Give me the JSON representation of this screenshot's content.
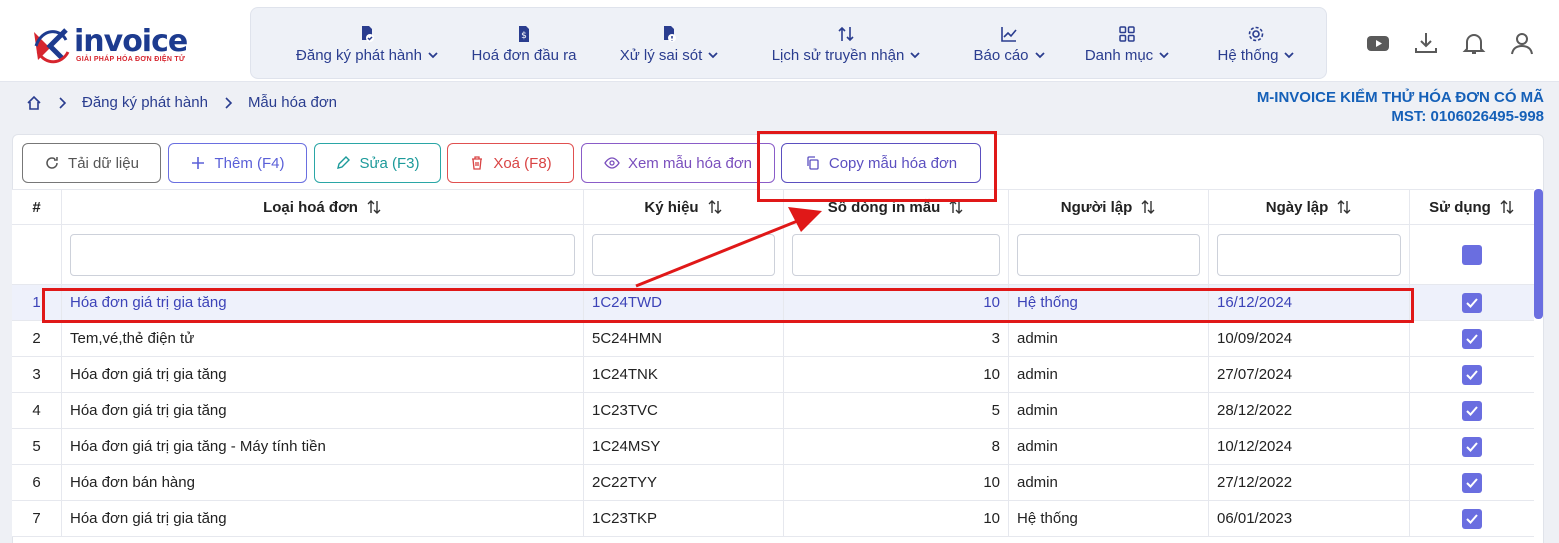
{
  "brand": {
    "name": "invoice",
    "tagline": "GIẢI PHÁP HÓA ĐƠN ĐIỆN TỬ"
  },
  "menu": [
    {
      "label": "Đăng ký phát hành",
      "icon": "file-check-icon",
      "dropdown": true
    },
    {
      "label": "Hoá đơn đầu ra",
      "icon": "file-dollar-icon",
      "dropdown": false
    },
    {
      "label": "Xử lý sai sót",
      "icon": "file-alert-icon",
      "dropdown": true
    },
    {
      "label": "Lịch sử truyền nhận",
      "icon": "arrows-updown-icon",
      "dropdown": true
    },
    {
      "label": "Báo cáo",
      "icon": "chart-line-icon",
      "dropdown": true
    },
    {
      "label": "Danh mục",
      "icon": "grid-icon",
      "dropdown": true
    },
    {
      "label": "Hệ thống",
      "icon": "gear-icon",
      "dropdown": true
    }
  ],
  "header_icons": [
    "youtube-icon",
    "download-icon",
    "bell-icon",
    "user-icon"
  ],
  "breadcrumb": {
    "home_icon": "home-icon",
    "items": [
      "Đăng ký phát hành",
      "Mẫu hóa đơn"
    ]
  },
  "company": {
    "name": "M-INVOICE KIỂM THỬ HÓA ĐƠN CÓ MÃ",
    "tax": "MST: 0106026495-998"
  },
  "toolbar": {
    "reload": "Tải dữ liệu",
    "add": "Thêm (F4)",
    "edit": "Sửa (F3)",
    "delete": "Xoá (F8)",
    "view": "Xem mẫu hóa đơn",
    "copy": "Copy mẫu hóa đơn"
  },
  "table": {
    "columns": [
      "#",
      "Loại hoá đơn",
      "Ký hiệu",
      "Số dòng in mẫu",
      "Người lập",
      "Ngày lập",
      "Sử dụng"
    ],
    "rows": [
      {
        "no": "1",
        "type": "Hóa đơn giá trị gia tăng",
        "code": "1C24TWD",
        "lines": "10",
        "creator": "Hệ thống",
        "date": "16/12/2024",
        "used": true,
        "selected": true
      },
      {
        "no": "2",
        "type": "Tem,vé,thẻ điện tử",
        "code": "5C24HMN",
        "lines": "3",
        "creator": "admin",
        "date": "10/09/2024",
        "used": true,
        "selected": false
      },
      {
        "no": "3",
        "type": "Hóa đơn giá trị gia tăng",
        "code": "1C24TNK",
        "lines": "10",
        "creator": "admin",
        "date": "27/07/2024",
        "used": true,
        "selected": false
      },
      {
        "no": "4",
        "type": "Hóa đơn giá trị gia tăng",
        "code": "1C23TVC",
        "lines": "5",
        "creator": "admin",
        "date": "28/12/2022",
        "used": true,
        "selected": false
      },
      {
        "no": "5",
        "type": "Hóa đơn giá trị gia tăng - Máy tính tiền",
        "code": "1C24MSY",
        "lines": "8",
        "creator": "admin",
        "date": "10/12/2024",
        "used": true,
        "selected": false
      },
      {
        "no": "6",
        "type": "Hóa đơn bán hàng",
        "code": "2C22TYY",
        "lines": "10",
        "creator": "admin",
        "date": "27/12/2022",
        "used": true,
        "selected": false
      },
      {
        "no": "7",
        "type": "Hóa đơn giá trị gia tăng",
        "code": "1C23TKP",
        "lines": "10",
        "creator": "Hệ thống",
        "date": "06/01/2023",
        "used": true,
        "selected": false
      }
    ]
  },
  "colors": {
    "accent": "#2a3d8f",
    "primary_check": "#6a6ee0",
    "annotation": "#e01818",
    "company": "#1560b8"
  }
}
